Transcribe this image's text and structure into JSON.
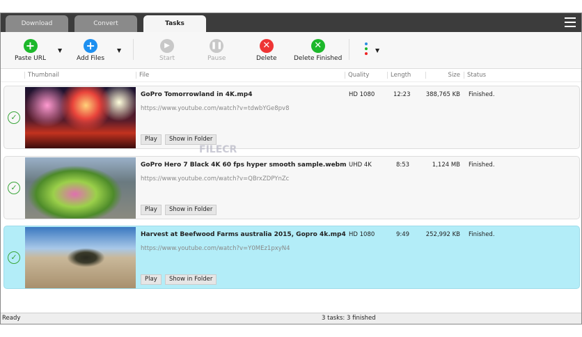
{
  "tabs": [
    {
      "label": "Download"
    },
    {
      "label": "Convert"
    },
    {
      "label": "Tasks"
    }
  ],
  "toolbar": {
    "paste_url": "Paste URL",
    "add_files": "Add Files",
    "start": "Start",
    "pause": "Pause",
    "delete": "Delete",
    "delete_finished": "Delete Finished"
  },
  "columns": {
    "thumbnail": "Thumbnail",
    "file": "File",
    "quality": "Quality",
    "length": "Length",
    "size": "Size",
    "status": "Status"
  },
  "tasks": [
    {
      "title": "GoPro  Tomorrowland in 4K.mp4",
      "url": "https://www.youtube.com/watch?v=tdwbYGe8pv8",
      "quality": "HD 1080",
      "length": "12:23",
      "size": "388,765 KB",
      "status": "Finished.",
      "play": "Play",
      "folder": "Show in Folder"
    },
    {
      "title": "GoPro Hero 7 Black 4K 60 fps hyper smooth sample.webm",
      "url": "https://www.youtube.com/watch?v=QBrxZDPYnZc",
      "quality": "UHD 4K",
      "length": "8:53",
      "size": "1,124 MB",
      "status": "Finished.",
      "play": "Play",
      "folder": "Show in Folder"
    },
    {
      "title": "Harvest at Beefwood Farms australia 2015, Gopro 4k.mp4",
      "url": "https://www.youtube.com/watch?v=Y0MEz1pxyN4",
      "quality": "HD 1080",
      "length": "9:49",
      "size": "252,992 KB",
      "status": "Finished.",
      "play": "Play",
      "folder": "Show in Folder"
    }
  ],
  "statusbar": {
    "left": "Ready",
    "center": "3 tasks: 3 finished"
  },
  "watermark": "FILECR"
}
